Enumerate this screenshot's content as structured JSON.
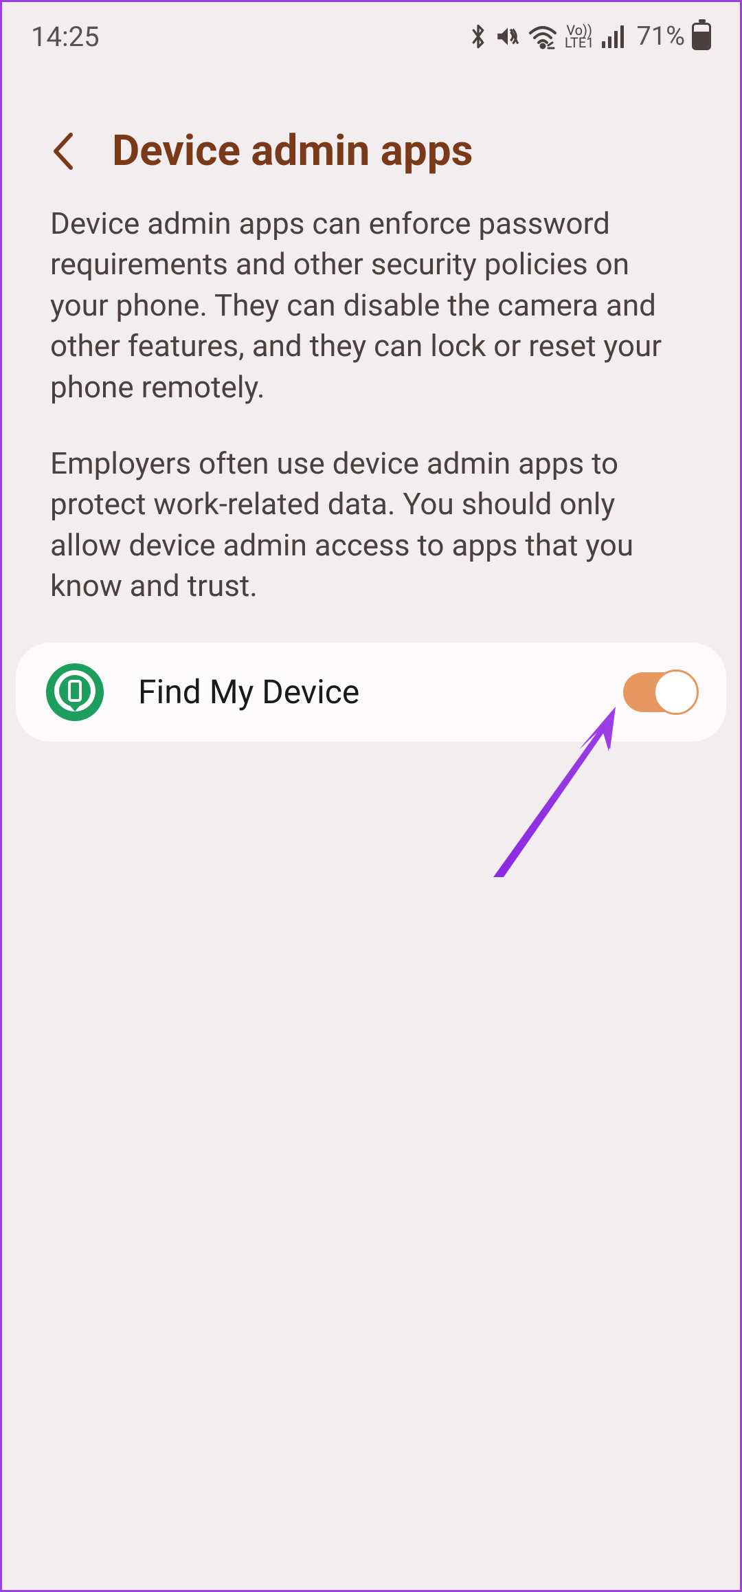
{
  "status": {
    "time": "14:25",
    "battery_pct": "71%",
    "lte_top": "Vo))",
    "lte_bottom": "LTE1"
  },
  "header": {
    "title": "Device admin apps"
  },
  "description": {
    "p1": "Device admin apps can enforce password requirements and other security policies on your phone. They can disable the camera and other features, and they can lock or reset your phone remotely.",
    "p2": "Employers often use device admin apps to protect work-related data. You should only allow device admin access to apps that you know and trust."
  },
  "apps": [
    {
      "label": "Find My Device",
      "enabled": true
    }
  ],
  "annotation": {
    "arrow_color": "#8a2be2"
  }
}
